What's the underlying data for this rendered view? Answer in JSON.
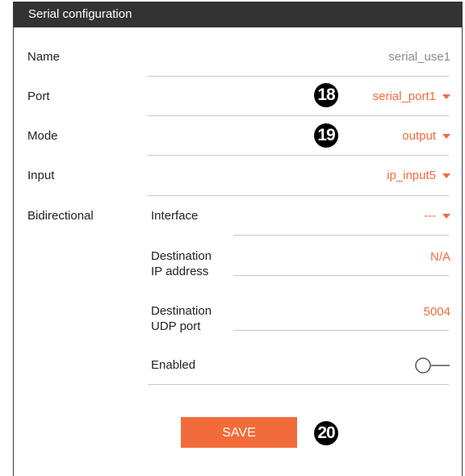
{
  "title": "Serial configuration",
  "rows": {
    "name": {
      "label": "Name",
      "value": "serial_use1"
    },
    "port": {
      "label": "Port",
      "value": "serial_port1"
    },
    "mode": {
      "label": "Mode",
      "value": "output"
    },
    "input": {
      "label": "Input",
      "value": "ip_input5"
    },
    "bidirectional": {
      "label": "Bidirectional"
    }
  },
  "bidir": {
    "interface": {
      "label": "Interface",
      "value": "---"
    },
    "dest_ip": {
      "label_line1": "Destination",
      "label_line2": "IP address",
      "value": "N/A"
    },
    "dest_udp": {
      "label_line1": "Destination",
      "label_line2": "UDP port",
      "value": "5004"
    },
    "enabled": {
      "label": "Enabled",
      "on": false
    }
  },
  "save_label": "SAVE",
  "callouts": {
    "port": "18",
    "mode": "19",
    "save": "20"
  },
  "colors": {
    "accent": "#f26b3a",
    "titlebar": "#333333",
    "muted": "#8a8a8a"
  }
}
